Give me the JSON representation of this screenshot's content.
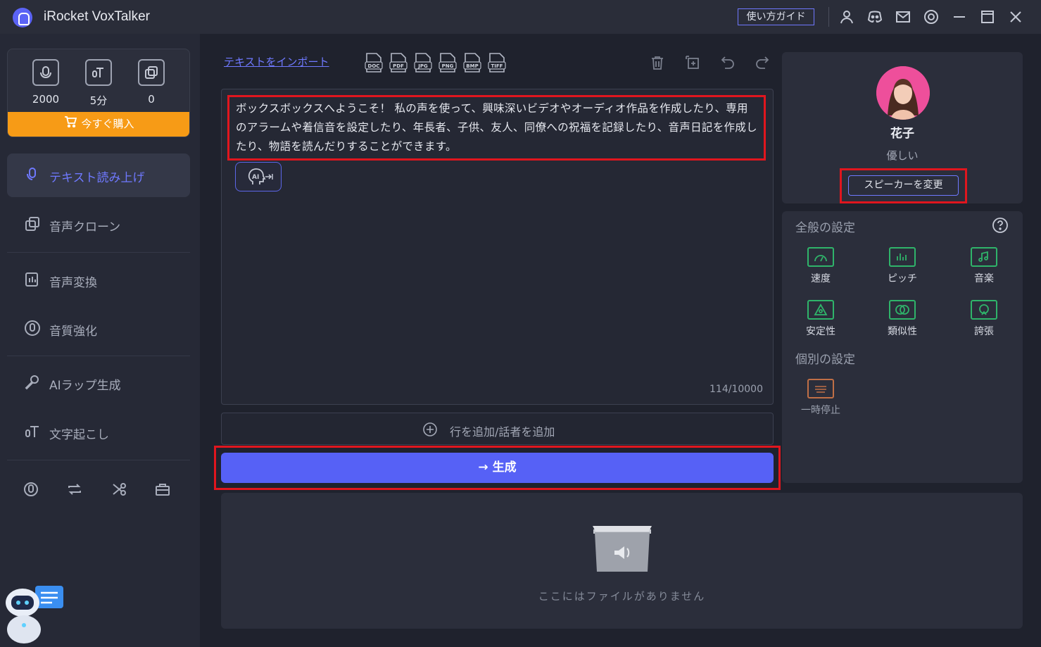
{
  "app": {
    "title": "iRocket VoxTalker"
  },
  "titlebar": {
    "guide_label": "使い方ガイド",
    "icons": [
      "user-icon",
      "discord-icon",
      "mail-icon",
      "settings-icon",
      "minimize-icon",
      "maximize-icon",
      "close-icon"
    ]
  },
  "quota": {
    "items": [
      {
        "icon": "text-voice-icon",
        "value": "2000"
      },
      {
        "icon": "transcribe-icon",
        "value": "5分"
      },
      {
        "icon": "clone-icon",
        "value": "0"
      }
    ],
    "buy_label": "今すぐ購入"
  },
  "sidebar": {
    "items": [
      {
        "label": "テキスト読み上げ",
        "icon": "tts-icon",
        "active": true
      },
      {
        "label": "音声クローン",
        "icon": "voice-clone-icon"
      },
      {
        "label": "音声変換",
        "icon": "voice-convert-icon"
      },
      {
        "label": "音質強化",
        "icon": "audio-enhance-icon"
      },
      {
        "label": "AIラップ生成",
        "icon": "microphone-icon"
      },
      {
        "label": "文字起こし",
        "icon": "transcribe-icon"
      }
    ],
    "tools": [
      "voice-record-icon",
      "loop-icon",
      "cut-icon",
      "toolbox-icon"
    ]
  },
  "editor": {
    "import_label": "テキストをインポート",
    "file_types": [
      "DOC",
      "PDF",
      "JPG",
      "PNG",
      "BMP",
      "TIFF"
    ],
    "text": "ボックスボックスへようこそ！ 私の声を使って、興味深いビデオやオーディオ作品を作成したり、専用のアラームや着信音を設定したり、年長者、子供、友人、同僚への祝福を記録したり、音声日記を作成したり、物語を読んだりすることができます。",
    "ai_button": "AI",
    "char_count": "114/10000",
    "add_line_label": "行を追加/話者を追加",
    "generate_label": "生成"
  },
  "files": {
    "empty_label": "ここにはファイルがありません"
  },
  "speaker": {
    "name": "花子",
    "style": "優しい",
    "change_label": "スピーカーを変更"
  },
  "settings": {
    "general_title": "全般の設定",
    "general_items": [
      {
        "label": "速度",
        "icon": "speed-icon"
      },
      {
        "label": "ピッチ",
        "icon": "pitch-icon"
      },
      {
        "label": "音楽",
        "icon": "music-icon"
      },
      {
        "label": "安定性",
        "icon": "stability-icon"
      },
      {
        "label": "類似性",
        "icon": "similarity-icon"
      },
      {
        "label": "誇張",
        "icon": "exaggeration-icon"
      }
    ],
    "individual_title": "個別の設定",
    "individual_items": [
      {
        "label": "一時停止",
        "icon": "pause-icon"
      }
    ]
  },
  "colors": {
    "accent": "#5661f6",
    "buy": "#f79b16",
    "highlight": "#e0161e",
    "setting_icon": "#2fb46a"
  }
}
